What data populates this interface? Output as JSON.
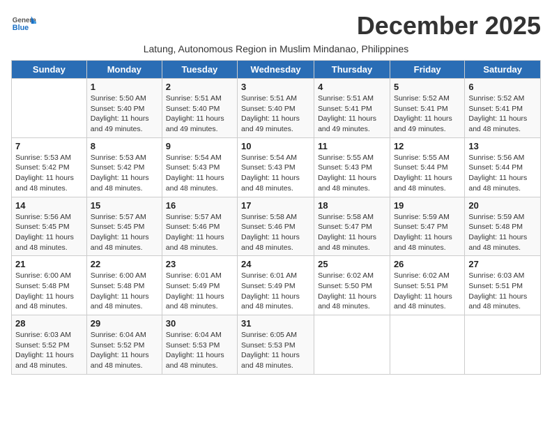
{
  "header": {
    "logo_general": "General",
    "logo_blue": "Blue",
    "month_title": "December 2025",
    "subtitle": "Latung, Autonomous Region in Muslim Mindanao, Philippines"
  },
  "weekdays": [
    "Sunday",
    "Monday",
    "Tuesday",
    "Wednesday",
    "Thursday",
    "Friday",
    "Saturday"
  ],
  "weeks": [
    [
      {
        "day": "",
        "info": ""
      },
      {
        "day": "1",
        "info": "Sunrise: 5:50 AM\nSunset: 5:40 PM\nDaylight: 11 hours\nand 49 minutes."
      },
      {
        "day": "2",
        "info": "Sunrise: 5:51 AM\nSunset: 5:40 PM\nDaylight: 11 hours\nand 49 minutes."
      },
      {
        "day": "3",
        "info": "Sunrise: 5:51 AM\nSunset: 5:40 PM\nDaylight: 11 hours\nand 49 minutes."
      },
      {
        "day": "4",
        "info": "Sunrise: 5:51 AM\nSunset: 5:41 PM\nDaylight: 11 hours\nand 49 minutes."
      },
      {
        "day": "5",
        "info": "Sunrise: 5:52 AM\nSunset: 5:41 PM\nDaylight: 11 hours\nand 49 minutes."
      },
      {
        "day": "6",
        "info": "Sunrise: 5:52 AM\nSunset: 5:41 PM\nDaylight: 11 hours\nand 48 minutes."
      }
    ],
    [
      {
        "day": "7",
        "info": "Sunrise: 5:53 AM\nSunset: 5:42 PM\nDaylight: 11 hours\nand 48 minutes."
      },
      {
        "day": "8",
        "info": "Sunrise: 5:53 AM\nSunset: 5:42 PM\nDaylight: 11 hours\nand 48 minutes."
      },
      {
        "day": "9",
        "info": "Sunrise: 5:54 AM\nSunset: 5:43 PM\nDaylight: 11 hours\nand 48 minutes."
      },
      {
        "day": "10",
        "info": "Sunrise: 5:54 AM\nSunset: 5:43 PM\nDaylight: 11 hours\nand 48 minutes."
      },
      {
        "day": "11",
        "info": "Sunrise: 5:55 AM\nSunset: 5:43 PM\nDaylight: 11 hours\nand 48 minutes."
      },
      {
        "day": "12",
        "info": "Sunrise: 5:55 AM\nSunset: 5:44 PM\nDaylight: 11 hours\nand 48 minutes."
      },
      {
        "day": "13",
        "info": "Sunrise: 5:56 AM\nSunset: 5:44 PM\nDaylight: 11 hours\nand 48 minutes."
      }
    ],
    [
      {
        "day": "14",
        "info": "Sunrise: 5:56 AM\nSunset: 5:45 PM\nDaylight: 11 hours\nand 48 minutes."
      },
      {
        "day": "15",
        "info": "Sunrise: 5:57 AM\nSunset: 5:45 PM\nDaylight: 11 hours\nand 48 minutes."
      },
      {
        "day": "16",
        "info": "Sunrise: 5:57 AM\nSunset: 5:46 PM\nDaylight: 11 hours\nand 48 minutes."
      },
      {
        "day": "17",
        "info": "Sunrise: 5:58 AM\nSunset: 5:46 PM\nDaylight: 11 hours\nand 48 minutes."
      },
      {
        "day": "18",
        "info": "Sunrise: 5:58 AM\nSunset: 5:47 PM\nDaylight: 11 hours\nand 48 minutes."
      },
      {
        "day": "19",
        "info": "Sunrise: 5:59 AM\nSunset: 5:47 PM\nDaylight: 11 hours\nand 48 minutes."
      },
      {
        "day": "20",
        "info": "Sunrise: 5:59 AM\nSunset: 5:48 PM\nDaylight: 11 hours\nand 48 minutes."
      }
    ],
    [
      {
        "day": "21",
        "info": "Sunrise: 6:00 AM\nSunset: 5:48 PM\nDaylight: 11 hours\nand 48 minutes."
      },
      {
        "day": "22",
        "info": "Sunrise: 6:00 AM\nSunset: 5:48 PM\nDaylight: 11 hours\nand 48 minutes."
      },
      {
        "day": "23",
        "info": "Sunrise: 6:01 AM\nSunset: 5:49 PM\nDaylight: 11 hours\nand 48 minutes."
      },
      {
        "day": "24",
        "info": "Sunrise: 6:01 AM\nSunset: 5:49 PM\nDaylight: 11 hours\nand 48 minutes."
      },
      {
        "day": "25",
        "info": "Sunrise: 6:02 AM\nSunset: 5:50 PM\nDaylight: 11 hours\nand 48 minutes."
      },
      {
        "day": "26",
        "info": "Sunrise: 6:02 AM\nSunset: 5:51 PM\nDaylight: 11 hours\nand 48 minutes."
      },
      {
        "day": "27",
        "info": "Sunrise: 6:03 AM\nSunset: 5:51 PM\nDaylight: 11 hours\nand 48 minutes."
      }
    ],
    [
      {
        "day": "28",
        "info": "Sunrise: 6:03 AM\nSunset: 5:52 PM\nDaylight: 11 hours\nand 48 minutes."
      },
      {
        "day": "29",
        "info": "Sunrise: 6:04 AM\nSunset: 5:52 PM\nDaylight: 11 hours\nand 48 minutes."
      },
      {
        "day": "30",
        "info": "Sunrise: 6:04 AM\nSunset: 5:53 PM\nDaylight: 11 hours\nand 48 minutes."
      },
      {
        "day": "31",
        "info": "Sunrise: 6:05 AM\nSunset: 5:53 PM\nDaylight: 11 hours\nand 48 minutes."
      },
      {
        "day": "",
        "info": ""
      },
      {
        "day": "",
        "info": ""
      },
      {
        "day": "",
        "info": ""
      }
    ]
  ]
}
